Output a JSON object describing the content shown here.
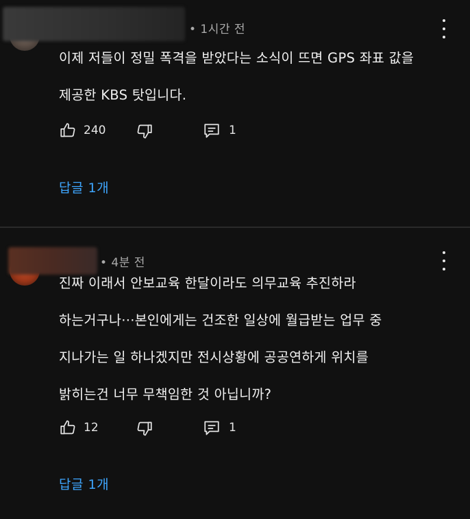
{
  "comments": [
    {
      "time": "• 1시간 전",
      "text": "이제 저들이 정밀 폭격을 받았다는 소식이 뜨면 GPS 좌표 값을\n제공한 KBS 탓입니다.",
      "likes": "240",
      "reply_count": "1",
      "replies_label": "답글 1개"
    },
    {
      "time": "• 4분 전",
      "text": "진짜 이래서 안보교육 한달이라도 의무교육 추진하라\n하는거구나···본인에게는 건조한 일상에 월급받는 업무 중\n지나가는 일 하나겠지만 전시상황에 공공연하게 위치를\n밝히는건 너무 무책임한 것 아닙니까?",
      "likes": "12",
      "reply_count": "1",
      "replies_label": "답글 1개"
    }
  ],
  "icons": {
    "like": "thumbs-up-icon",
    "dislike": "thumbs-down-icon",
    "reply": "comment-icon",
    "more": "more-vertical-icon"
  },
  "colors": {
    "background": "#111111",
    "text": "#f1f1f1",
    "meta": "#aaaaaa",
    "link": "#3ea6ff"
  }
}
